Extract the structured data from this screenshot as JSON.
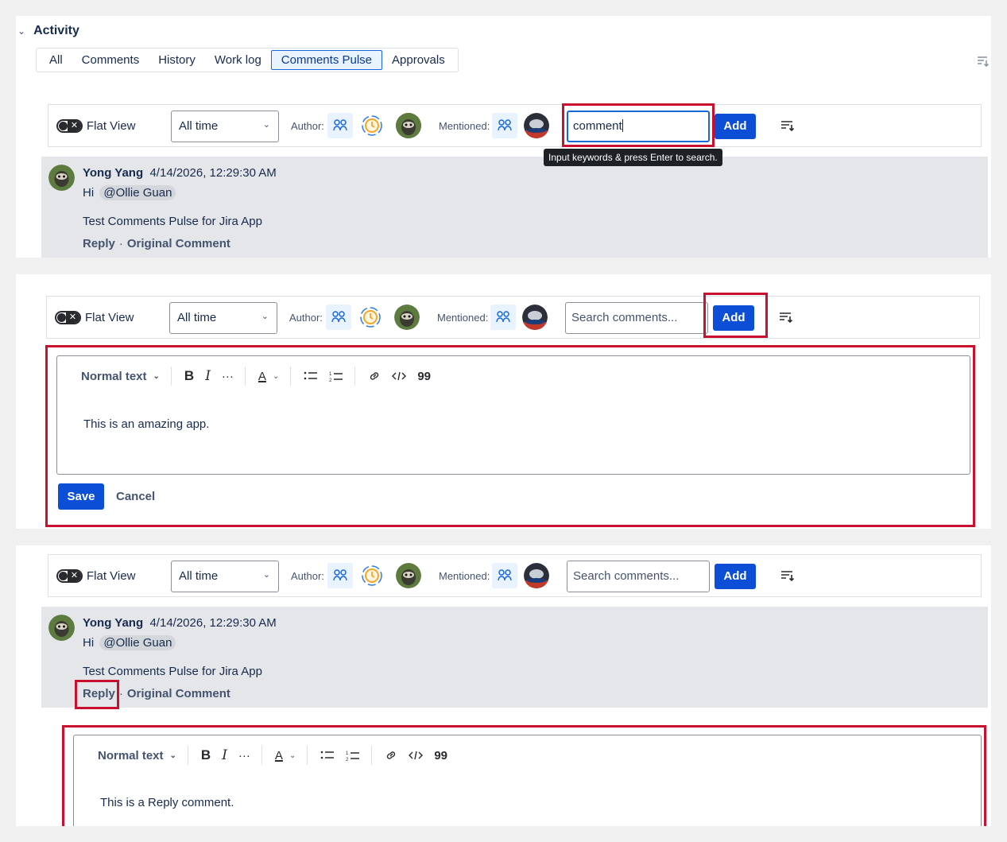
{
  "activity": {
    "title": "Activity",
    "tabs": [
      "All",
      "Comments",
      "History",
      "Work log",
      "Comments Pulse",
      "Approvals"
    ],
    "active_tab": "Comments Pulse"
  },
  "toolbar": {
    "flat_view_label": "Flat View",
    "time_filter": "All time",
    "author_label": "Author:",
    "mentioned_label": "Mentioned:",
    "add_label": "Add",
    "search_placeholder": "Search comments...",
    "search_value_typed": "comment"
  },
  "tooltip": "Input keywords & press Enter to search.",
  "comment": {
    "author": "Yong Yang",
    "timestamp": "4/14/2026, 12:29:30 AM",
    "greeting": "Hi",
    "mention": "@Ollie Guan",
    "body": "Test Comments Pulse for Jira App",
    "reply_label": "Reply",
    "separator": "·",
    "original_label": "Original Comment"
  },
  "editor": {
    "text_style": "Normal text",
    "bold": "B",
    "italic": "I",
    "more": "···",
    "text_color": "A",
    "quote": "99",
    "add_comment_text": "This is an amazing app.",
    "reply_text": "This is a Reply comment.",
    "save_label": "Save",
    "cancel_label": "Cancel"
  },
  "colors": {
    "accent": "#0c4fd6",
    "highlight": "#c9102f",
    "comment_bg": "#e4e6ea"
  }
}
